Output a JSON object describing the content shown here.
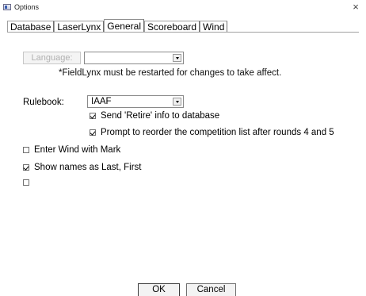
{
  "window": {
    "title": "Options",
    "close_label": "×"
  },
  "tabs": [
    {
      "label": "Database"
    },
    {
      "label": "LaserLynx"
    },
    {
      "label": "General"
    },
    {
      "label": "Scoreboard"
    },
    {
      "label": "Wind"
    }
  ],
  "language": {
    "button_label": "Language:",
    "selected": "",
    "note": "*FieldLynx must be restarted for changes to take affect."
  },
  "rulebook": {
    "label": "Rulebook:",
    "selected": "IAAF"
  },
  "options": {
    "send_retire": {
      "label": "Send 'Retire' info to database",
      "checked": true
    },
    "prompt_reorder": {
      "label": "Prompt to reorder the competition list after rounds 4 and 5",
      "checked": true
    },
    "wind_with_mark": {
      "label": "Enter Wind with Mark",
      "checked": false
    },
    "names_last_first": {
      "label": "Show names as Last, First",
      "checked": true
    },
    "unlabeled": {
      "label": "",
      "checked": false
    }
  },
  "buttons": {
    "ok": "OK",
    "cancel": "Cancel"
  }
}
